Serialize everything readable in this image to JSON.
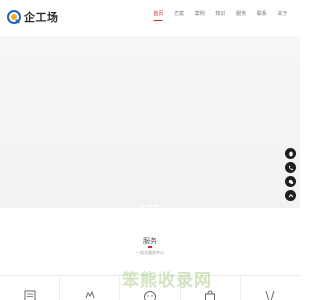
{
  "brand": {
    "name": "企工场"
  },
  "nav": {
    "items": [
      {
        "label": "首页",
        "active": true
      },
      {
        "label": "方案",
        "active": false
      },
      {
        "label": "案例",
        "active": false
      },
      {
        "label": "知识",
        "active": false
      },
      {
        "label": "服务",
        "active": false
      },
      {
        "label": "联系",
        "active": false
      },
      {
        "label": "关于",
        "active": false
      }
    ]
  },
  "hero": {
    "slide_count": 3,
    "active_slide": 1
  },
  "side_buttons": [
    "qq-icon",
    "phone-icon",
    "wechat-icon",
    "top-icon"
  ],
  "services": {
    "title": "服务",
    "subtitle": "一站式服务中心",
    "cards": [
      "document-icon",
      "cloud-icon",
      "support-icon",
      "bag-icon",
      "chart-icon"
    ]
  },
  "watermark": "笨熊收录网",
  "colors": {
    "accent": "#d9272e",
    "logo_blue": "#1f66c2",
    "logo_gold": "#f2b01e",
    "watermark": "#70aa3a"
  }
}
